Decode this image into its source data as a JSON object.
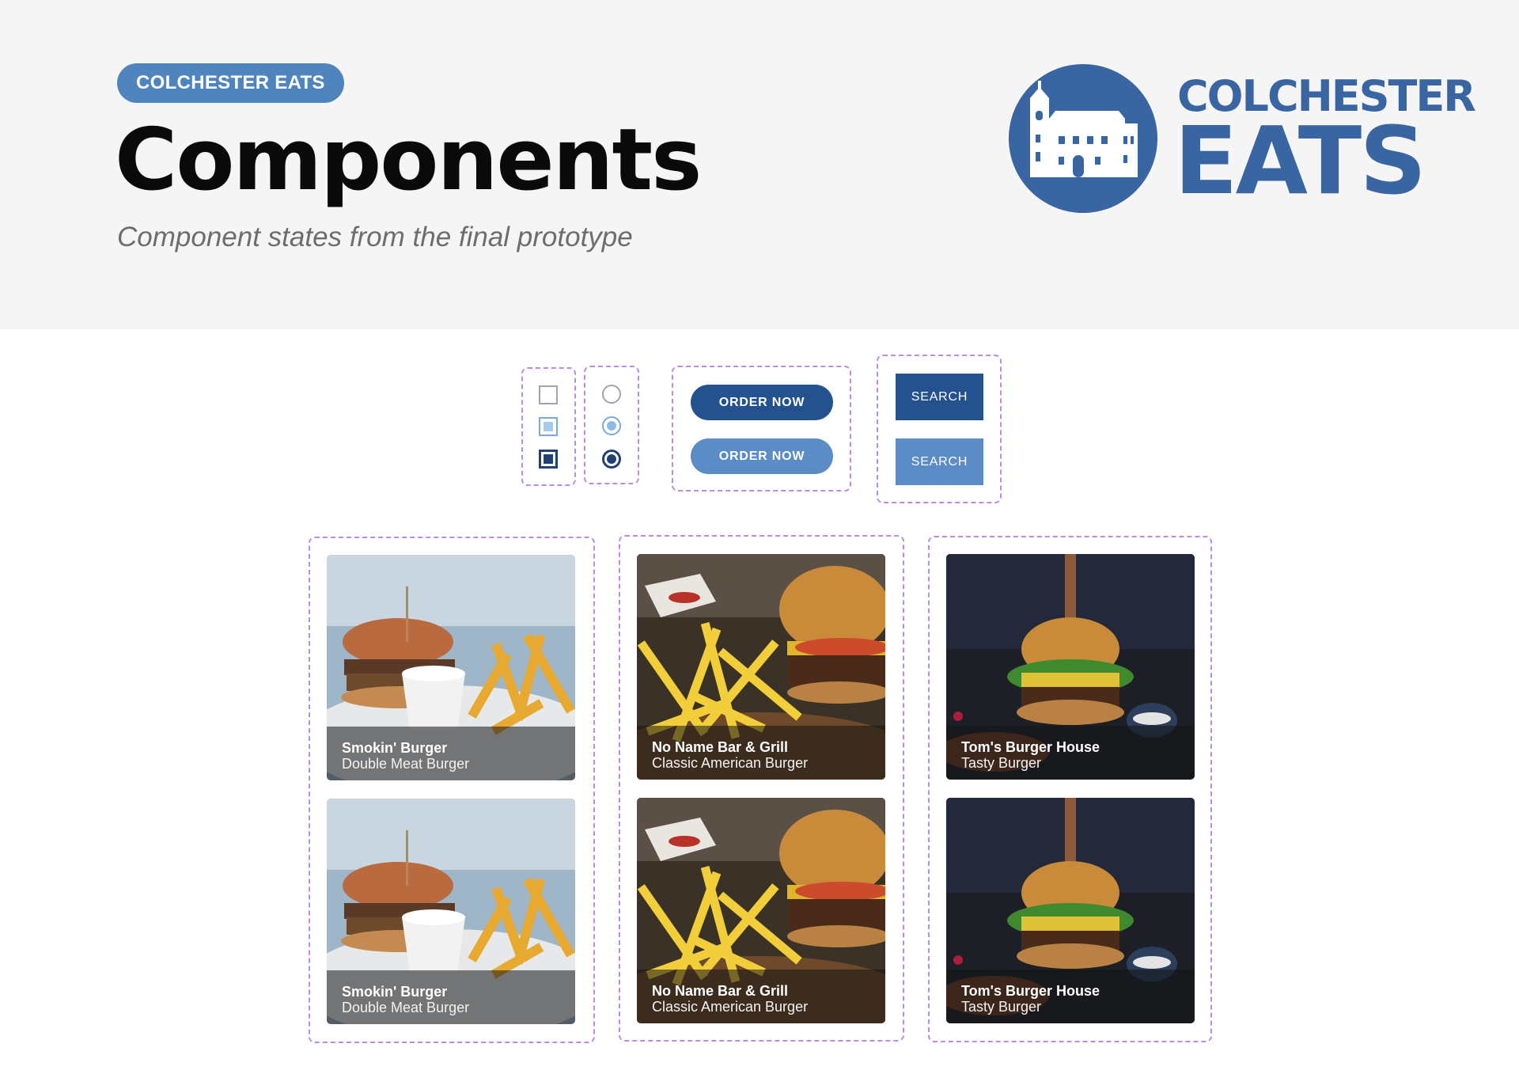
{
  "header": {
    "badge": "COLCHESTER EATS",
    "title": "Components",
    "subtitle": "Component states from the final prototype"
  },
  "logo": {
    "line1": "COLCHESTER",
    "line2": "EATS",
    "brand_color": "#3a65a3",
    "icon": "castle-icon"
  },
  "controls": {
    "checkbox_states": [
      "unchecked",
      "partial",
      "checked"
    ],
    "radio_states": [
      "unselected",
      "partial",
      "selected"
    ],
    "order_buttons": [
      "ORDER NOW",
      "ORDER NOW"
    ],
    "search_buttons": [
      "SEARCH",
      "SEARCH"
    ]
  },
  "colors": {
    "primary_dark": "#23528e",
    "primary_light": "#5b8cc6",
    "frame": "#b98be8"
  },
  "cards": [
    {
      "name": "Smokin' Burger",
      "dish": "Double Meat Burger"
    },
    {
      "name": "No Name Bar & Grill",
      "dish": "Classic American Burger"
    },
    {
      "name": "Tom's Burger House",
      "dish": "Tasty Burger"
    }
  ]
}
